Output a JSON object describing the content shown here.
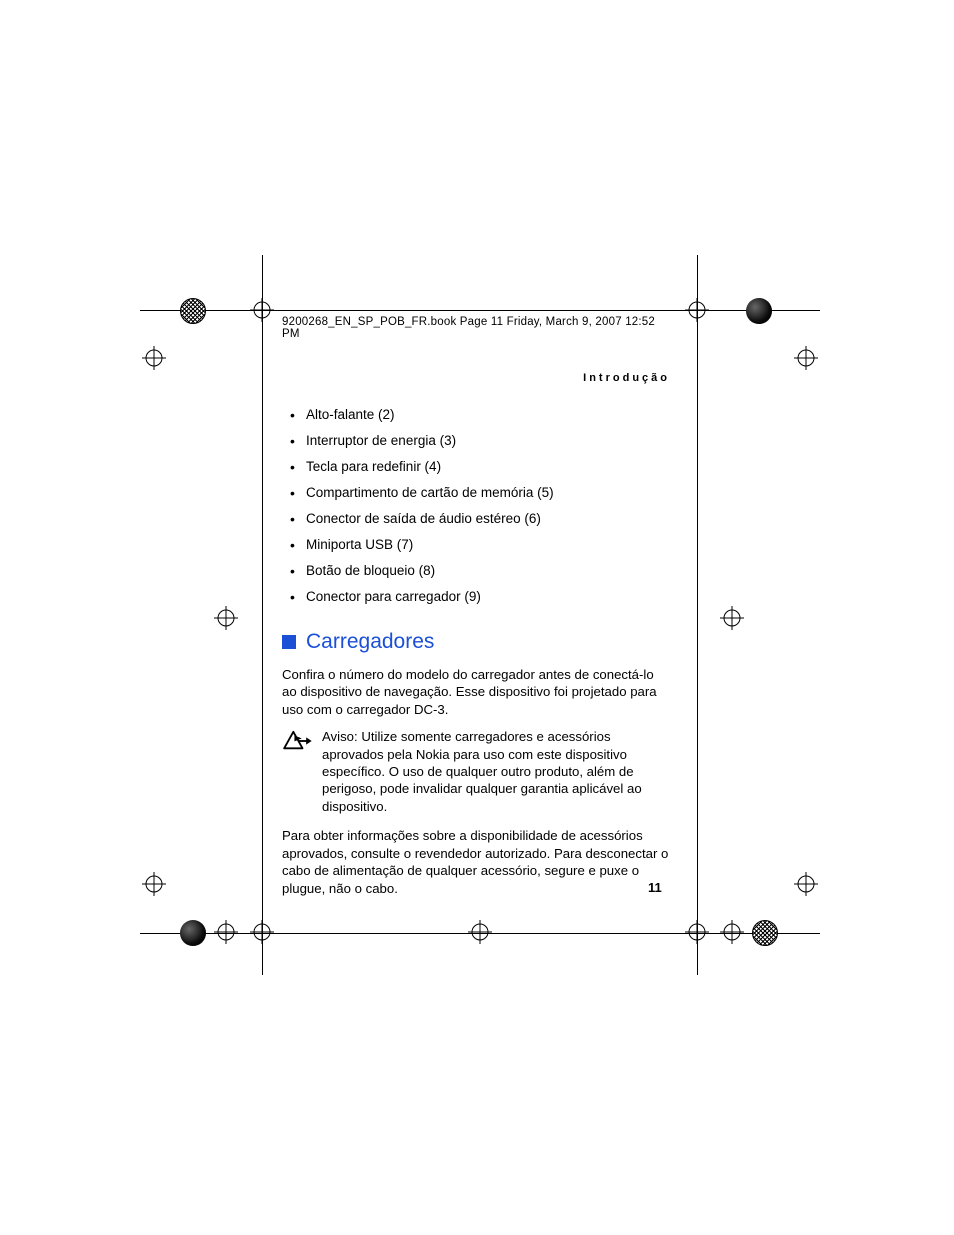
{
  "header_line": "9200268_EN_SP_POB_FR.book  Page 11  Friday, March 9, 2007  12:52 PM",
  "section_header": "Introdução",
  "bullets": [
    "Alto-falante (2)",
    "Interruptor de energia (3)",
    "Tecla para redefinir (4)",
    "Compartimento de cartão de memória (5)",
    "Conector de saída de áudio estéreo (6)",
    "Miniporta USB (7)",
    "Botão de bloqueio (8)",
    "Conector para carregador (9)"
  ],
  "heading": "Carregadores",
  "para1": "Confira o número do modelo do carregador antes de conectá-lo ao dispositivo de navegação. Esse dispositivo foi projetado para uso com o carregador DC-3.",
  "warning": "Aviso: Utilize somente carregadores e acessórios aprovados pela Nokia para uso com este dispositivo específico. O uso de qualquer outro produto, além de perigoso, pode invalidar qualquer garantia aplicável ao dispositivo.",
  "para2": "Para obter informações sobre a disponibilidade de acessórios aprovados, consulte o revendedor autorizado. Para desconectar o cabo de alimentação de qualquer acessório, segure e puxe o plugue, não o cabo.",
  "page_number": "11"
}
